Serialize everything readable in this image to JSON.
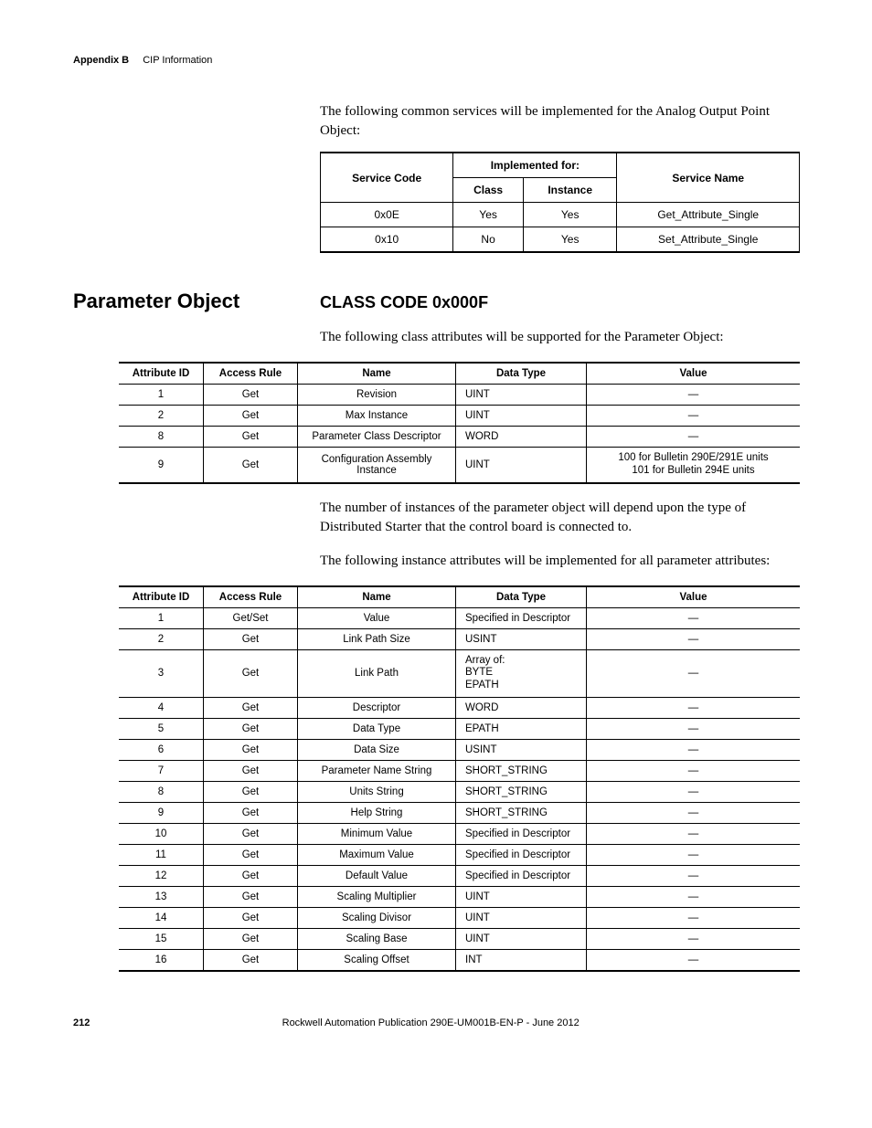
{
  "header": {
    "appendix": "Appendix B",
    "section": "CIP Information"
  },
  "intro1": "The following common services will be implemented for the Analog Output Point Object:",
  "table1": {
    "h_impl": "Implemented for:",
    "h_code": "Service Code",
    "h_class": "Class",
    "h_inst": "Instance",
    "h_name": "Service Name",
    "rows": [
      {
        "code": "0x0E",
        "class": "Yes",
        "inst": "Yes",
        "name": "Get_Attribute_Single"
      },
      {
        "code": "0x10",
        "class": "No",
        "inst": "Yes",
        "name": "Set_Attribute_Single"
      }
    ]
  },
  "section": {
    "title": "Parameter Object",
    "classcode": "CLASS CODE 0x000F"
  },
  "body1": "The following class attributes will be supported for the Parameter Object:",
  "table2": {
    "h_id": "Attribute ID",
    "h_rule": "Access Rule",
    "h_name": "Name",
    "h_dt": "Data Type",
    "h_val": "Value",
    "rows": [
      {
        "id": "1",
        "rule": "Get",
        "name": "Revision",
        "dt": "UINT",
        "val": "—"
      },
      {
        "id": "2",
        "rule": "Get",
        "name": "Max Instance",
        "dt": "UINT",
        "val": "—"
      },
      {
        "id": "8",
        "rule": "Get",
        "name": "Parameter Class Descriptor",
        "dt": "WORD",
        "val": "—"
      },
      {
        "id": "9",
        "rule": "Get",
        "name": "Configuration Assembly Instance",
        "dt": "UINT",
        "val": "100 for Bulletin 290E/291E units\n101 for Bulletin 294E units"
      }
    ]
  },
  "body2": "The number of instances of the parameter object will depend upon the type of Distributed Starter that the control board is connected to.",
  "body3": "The following instance attributes will be implemented for all parameter attributes:",
  "table3": {
    "h_id": "Attribute ID",
    "h_rule": "Access Rule",
    "h_name": "Name",
    "h_dt": "Data Type",
    "h_val": "Value",
    "rows": [
      {
        "id": "1",
        "rule": "Get/Set",
        "name": "Value",
        "dt": "Specified in Descriptor",
        "val": "—"
      },
      {
        "id": "2",
        "rule": "Get",
        "name": "Link Path Size",
        "dt": "USINT",
        "val": "—"
      },
      {
        "id": "3",
        "rule": "Get",
        "name": "Link Path",
        "dt": "Array of:\nBYTE\nEPATH",
        "val": "—"
      },
      {
        "id": "4",
        "rule": "Get",
        "name": "Descriptor",
        "dt": "WORD",
        "val": "—"
      },
      {
        "id": "5",
        "rule": "Get",
        "name": "Data Type",
        "dt": "EPATH",
        "val": "—"
      },
      {
        "id": "6",
        "rule": "Get",
        "name": "Data Size",
        "dt": "USINT",
        "val": "—"
      },
      {
        "id": "7",
        "rule": "Get",
        "name": "Parameter Name String",
        "dt": "SHORT_STRING",
        "val": "—"
      },
      {
        "id": "8",
        "rule": "Get",
        "name": "Units String",
        "dt": "SHORT_STRING",
        "val": "—"
      },
      {
        "id": "9",
        "rule": "Get",
        "name": "Help String",
        "dt": "SHORT_STRING",
        "val": "—"
      },
      {
        "id": "10",
        "rule": "Get",
        "name": "Minimum Value",
        "dt": "Specified in Descriptor",
        "val": "—"
      },
      {
        "id": "11",
        "rule": "Get",
        "name": "Maximum Value",
        "dt": "Specified in Descriptor",
        "val": "—"
      },
      {
        "id": "12",
        "rule": "Get",
        "name": "Default Value",
        "dt": "Specified in Descriptor",
        "val": "—"
      },
      {
        "id": "13",
        "rule": "Get",
        "name": "Scaling Multiplier",
        "dt": "UINT",
        "val": "—"
      },
      {
        "id": "14",
        "rule": "Get",
        "name": "Scaling Divisor",
        "dt": "UINT",
        "val": "—"
      },
      {
        "id": "15",
        "rule": "Get",
        "name": "Scaling Base",
        "dt": "UINT",
        "val": "—"
      },
      {
        "id": "16",
        "rule": "Get",
        "name": "Scaling Offset",
        "dt": "INT",
        "val": "—"
      }
    ]
  },
  "footer": {
    "page": "212",
    "pub": "Rockwell Automation Publication 290E-UM001B-EN-P - June 2012"
  }
}
